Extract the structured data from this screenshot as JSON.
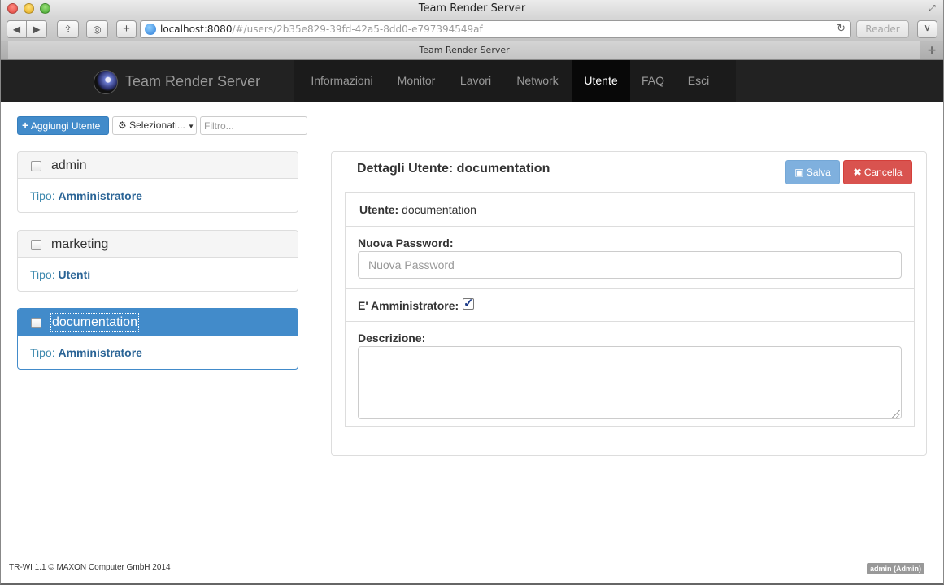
{
  "window": {
    "title": "Team Render Server"
  },
  "browser": {
    "url_host": "localhost:8080",
    "url_path": "/#/users/2b35e829-39fd-42a5-8dd0-e797394549af",
    "reader_label": "Reader",
    "tab_title": "Team Render Server"
  },
  "navbar": {
    "brand": "Team Render Server",
    "items": [
      {
        "label": "Informazioni"
      },
      {
        "label": "Monitor"
      },
      {
        "label": "Lavori"
      },
      {
        "label": "Network"
      },
      {
        "label": "Utente",
        "active": true
      },
      {
        "label": "FAQ"
      },
      {
        "label": "Esci"
      }
    ]
  },
  "actions": {
    "add_user_label": "Aggiungi Utente",
    "select_label": "Selezionati...",
    "filter_placeholder": "Filtro..."
  },
  "users": [
    {
      "name": "admin",
      "type_label": "Tipo:",
      "type": "Amministratore",
      "selected": false,
      "checked": false
    },
    {
      "name": "marketing",
      "type_label": "Tipo:",
      "type": "Utenti",
      "selected": false,
      "checked": false
    },
    {
      "name": "documentation",
      "type_label": "Tipo:",
      "type": "Amministratore",
      "selected": true,
      "checked": false
    }
  ],
  "details": {
    "title": "Dettagli Utente: documentation",
    "save_label": "Salva",
    "cancel_label": "Cancella",
    "user_label": "Utente:",
    "user_value": "documentation",
    "password_label": "Nuova Password:",
    "password_placeholder": "Nuova Password",
    "admin_label": "E' Amministratore:",
    "admin_checked": true,
    "description_label": "Descrizione:",
    "description_value": ""
  },
  "footer": {
    "copyright": "TR-WI 1.1 © MAXON Computer GmbH 2014",
    "current_user": "admin (Admin)"
  },
  "colors": {
    "primary": "#428bca",
    "danger": "#d9534f",
    "navbar": "#222222",
    "link": "#2a6496"
  }
}
